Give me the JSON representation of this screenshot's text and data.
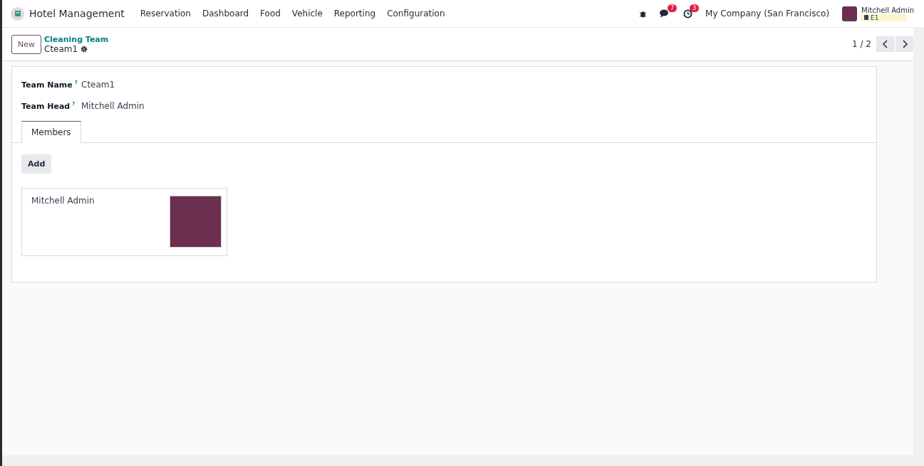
{
  "navbar": {
    "app_name": "Hotel Management",
    "menu": [
      "Reservation",
      "Dashboard",
      "Food",
      "Vehicle",
      "Reporting",
      "Configuration"
    ],
    "messages_badge": "7",
    "activities_badge": "3",
    "company": "My Company (San Francisco)",
    "user": {
      "name": "Mitchell Admin",
      "database": "E1"
    }
  },
  "control_panel": {
    "new_button": "New",
    "breadcrumb": "Cleaning Team",
    "record": "Cteam1",
    "pager": "1 / 2"
  },
  "form": {
    "fields": [
      {
        "label": "Team Name",
        "help": "?",
        "value": "Cteam1"
      },
      {
        "label": "Team Head",
        "help": "?",
        "value": "Mitchell Admin"
      }
    ],
    "tabs": [
      {
        "label": "Members",
        "selected": true
      }
    ],
    "add_button": "Add",
    "members": [
      {
        "name": "Mitchell Admin"
      }
    ]
  }
}
